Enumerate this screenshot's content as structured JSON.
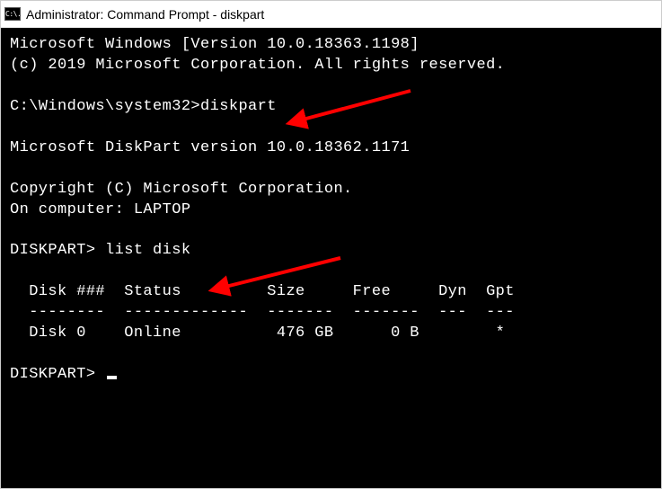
{
  "window": {
    "icon_text": "C:\\.",
    "title": "Administrator: Command Prompt - diskpart"
  },
  "terminal": {
    "line1": "Microsoft Windows [Version 10.0.18363.1198]",
    "line2": "(c) 2019 Microsoft Corporation. All rights reserved.",
    "prompt1_path": "C:\\Windows\\system32>",
    "prompt1_cmd": "diskpart",
    "diskpart_version": "Microsoft DiskPart version 10.0.18362.1171",
    "copyright": "Copyright (C) Microsoft Corporation.",
    "computer": "On computer: LAPTOP",
    "prompt2_label": "DISKPART> ",
    "prompt2_cmd": "list disk",
    "table_header": "  Disk ###  Status         Size     Free     Dyn  Gpt",
    "table_div": "  --------  -------------  -------  -------  ---  ---",
    "table_row0": "  Disk 0    Online          476 GB      0 B        *",
    "prompt3_label": "DISKPART> "
  }
}
